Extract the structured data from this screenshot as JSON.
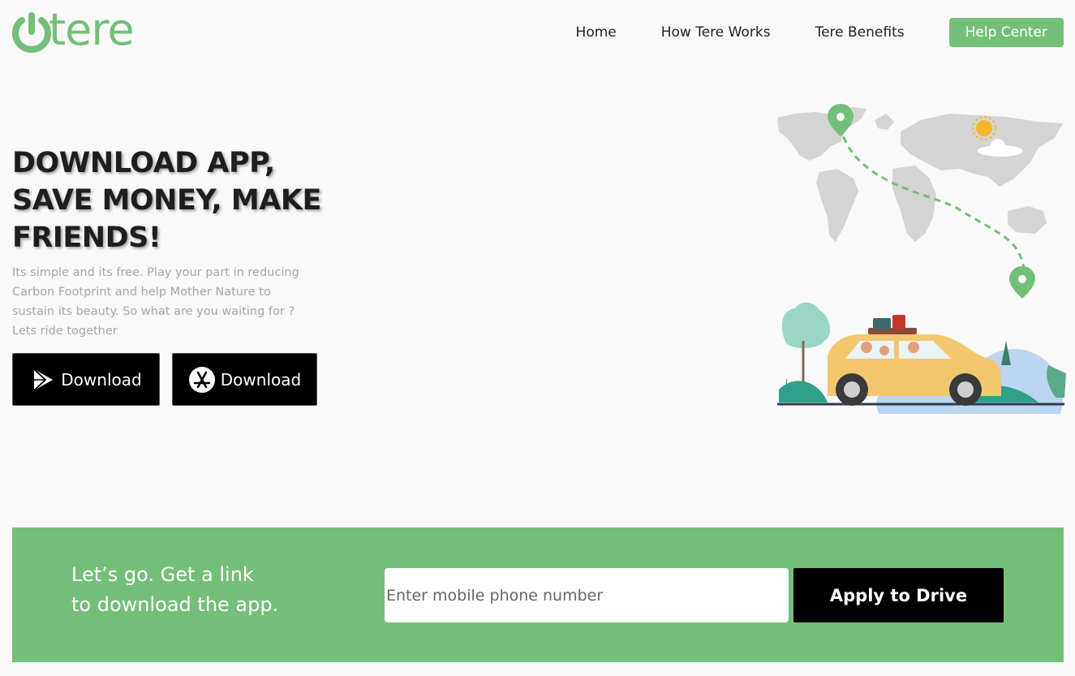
{
  "header": {
    "logo_text": "tere",
    "nav": {
      "home": "Home",
      "how": "How Tere Works",
      "benefits": "Tere Benefits",
      "help": "Help Center"
    }
  },
  "hero": {
    "title_line1": "DOWNLOAD APP,",
    "title_line2": "SAVE MONEY, MAKE",
    "title_line3": "FRIENDS!",
    "desc_line1": "Its simple and its free. Play your part in reducing",
    "desc_line2": "Carbon Footprint and help Mother Nature to",
    "desc_line3": "sustain its beauty. So what are you waiting for ?",
    "desc_line4": "Lets ride together",
    "play_button": "Download",
    "appstore_button": "Download"
  },
  "banner": {
    "line1": "Let’s go. Get a link",
    "line2": "to download the app.",
    "phone_placeholder": "Enter mobile phone number",
    "apply_button": "Apply to Drive"
  },
  "colors": {
    "brand_green": "#74bf78",
    "text_dark": "#1e1e1e",
    "text_muted": "#a6a6a6"
  },
  "icons": [
    "power-icon",
    "google-play-icon",
    "app-store-icon",
    "location-pin-icon",
    "sun-icon"
  ]
}
